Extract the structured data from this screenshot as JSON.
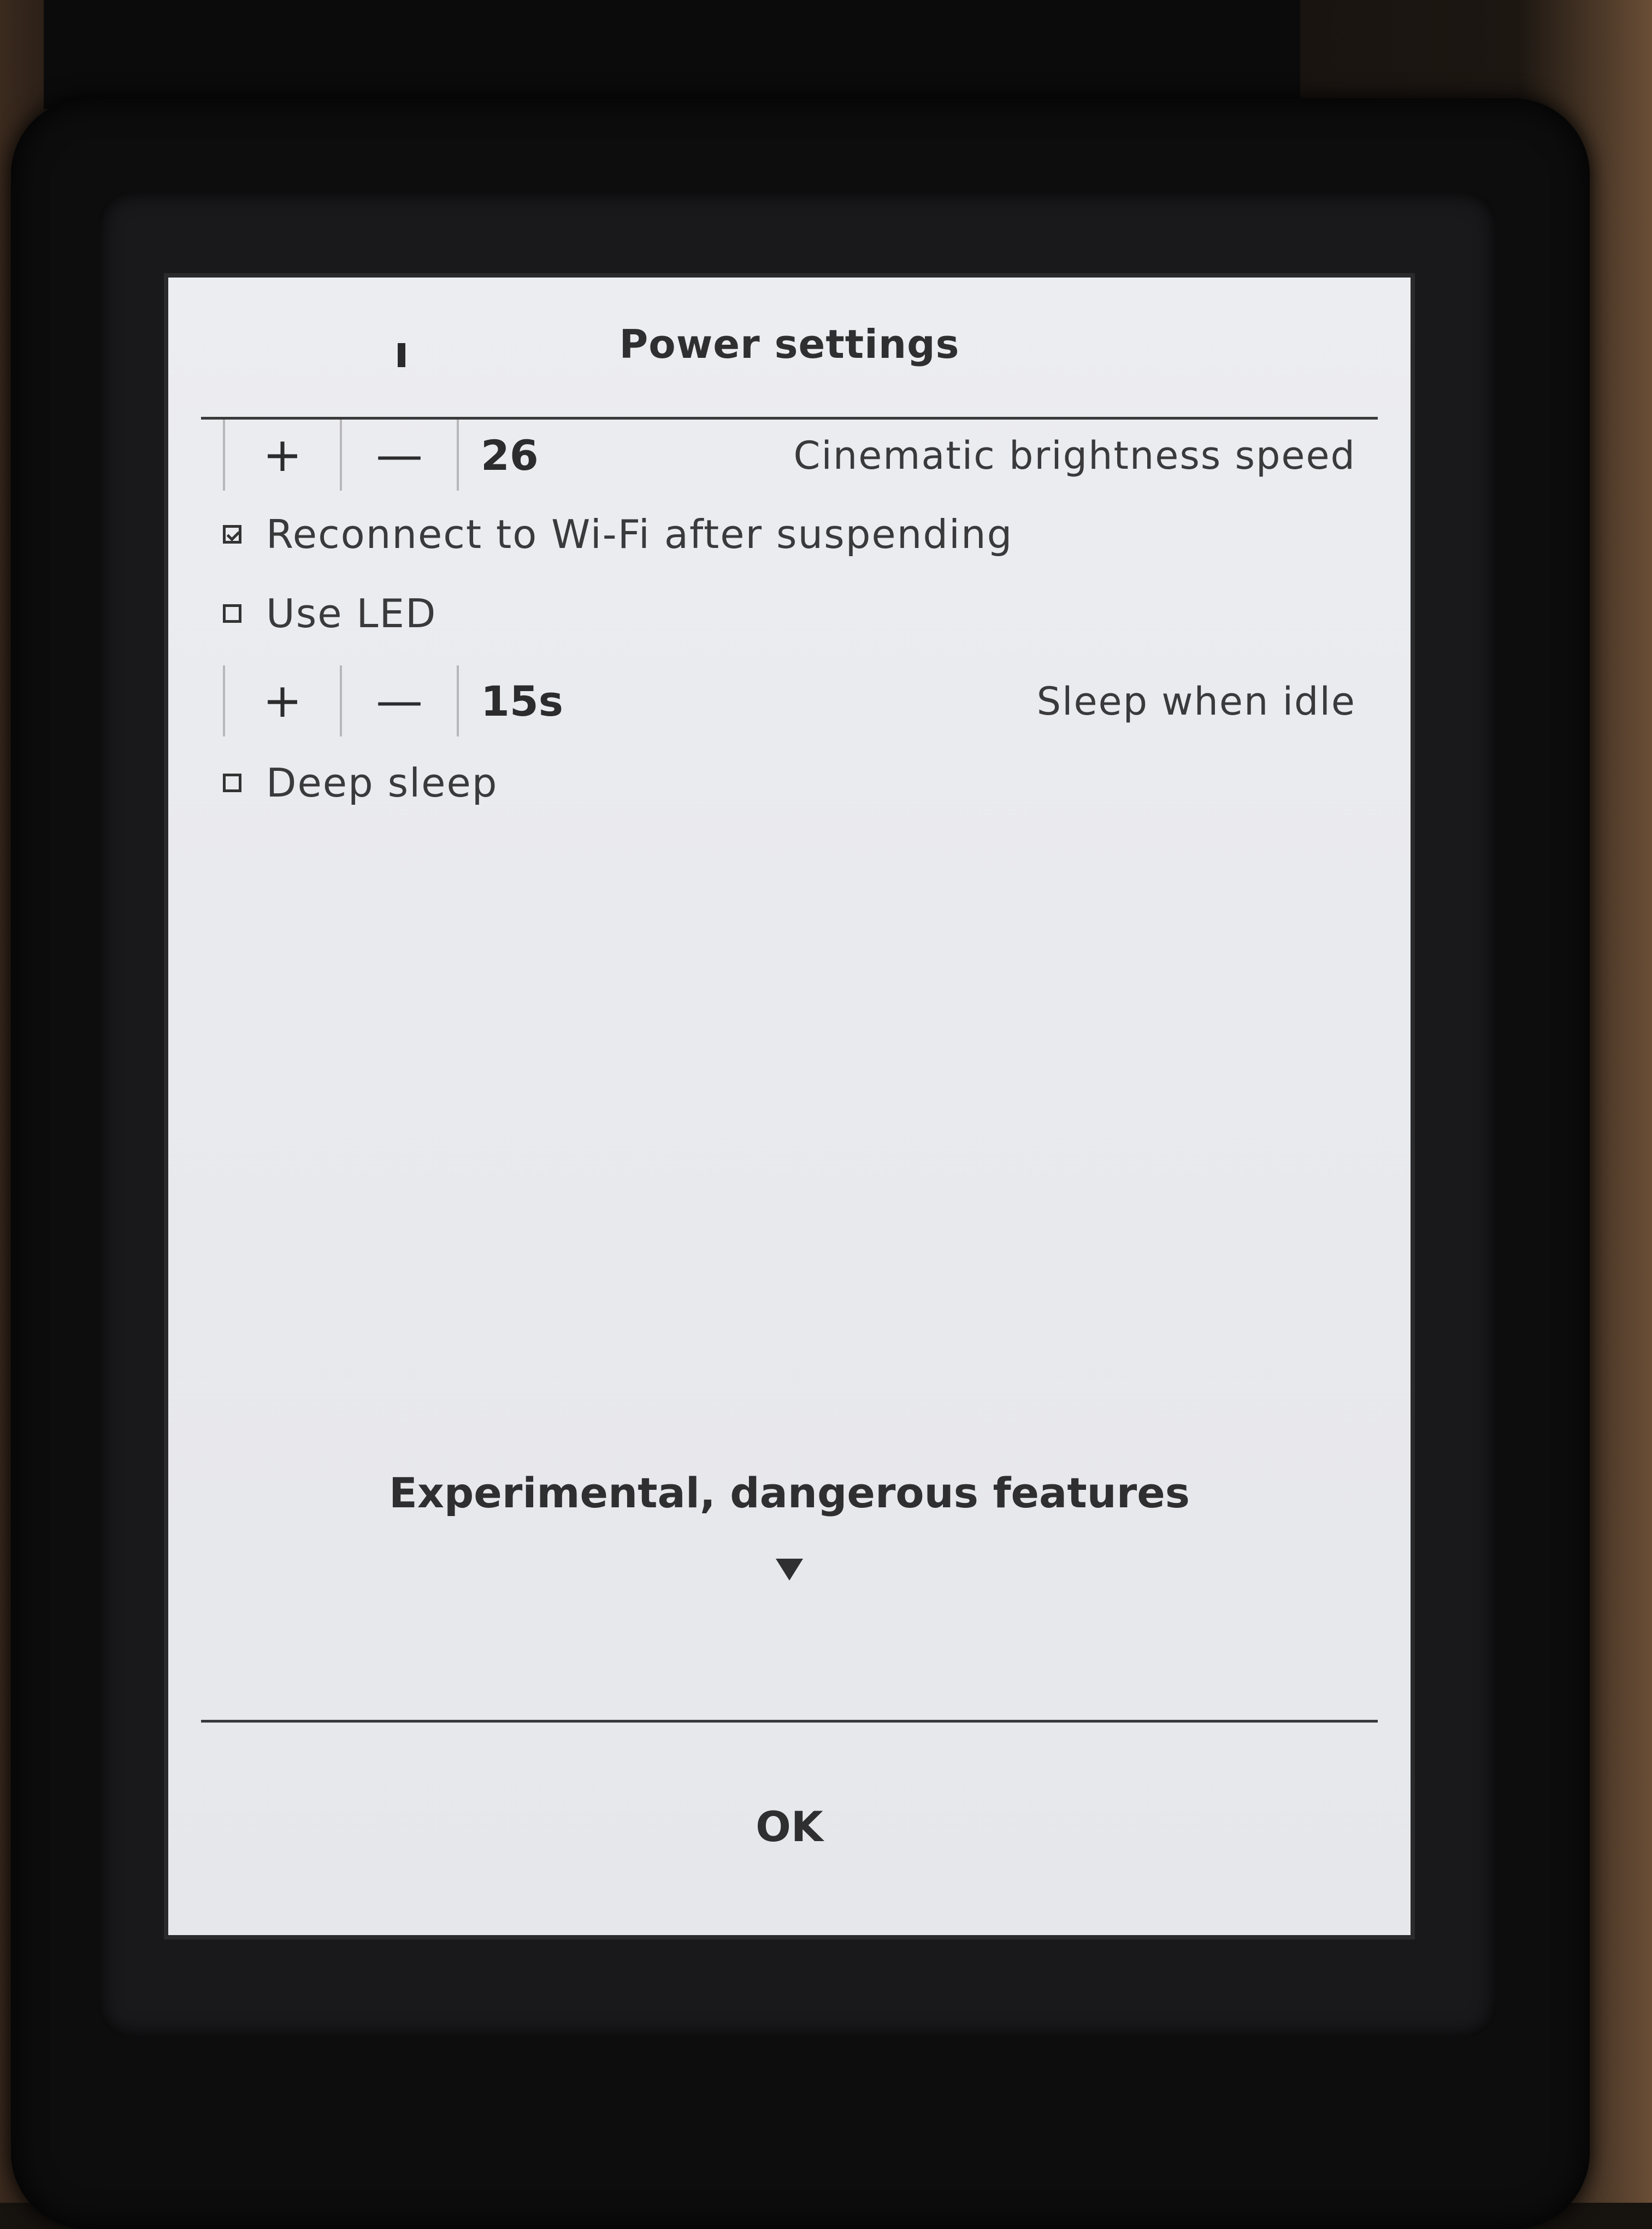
{
  "dialog": {
    "title": "Power settings",
    "ok_label": "OK"
  },
  "settings": {
    "brightness": {
      "plus": "+",
      "minus": "—",
      "value": "26",
      "label": "Cinematic brightness speed"
    },
    "reconnect_wifi": {
      "checked": true,
      "label": "Reconnect to Wi-Fi after suspending"
    },
    "use_led": {
      "checked": false,
      "label": "Use LED"
    },
    "sleep_idle": {
      "plus": "+",
      "minus": "—",
      "value": "15s",
      "label": "Sleep when idle"
    },
    "deep_sleep": {
      "checked": false,
      "label": "Deep sleep"
    }
  },
  "experimental": {
    "label": "Experimental, dangerous features"
  }
}
